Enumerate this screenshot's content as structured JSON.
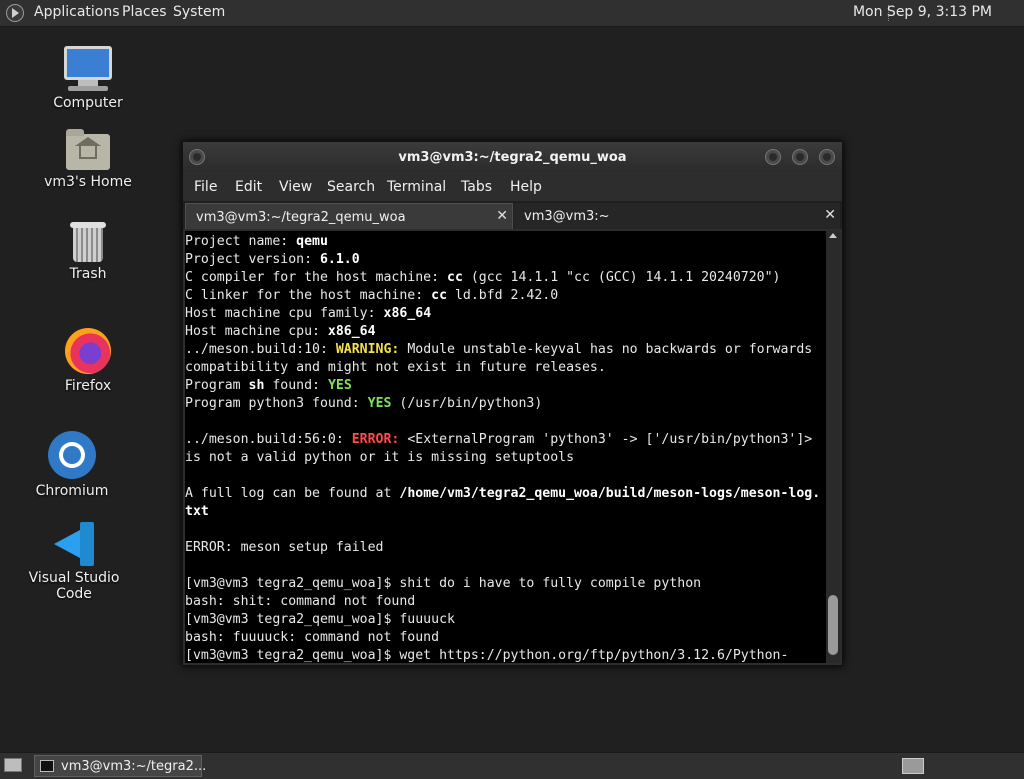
{
  "top_panel": {
    "menus": [
      "Applications",
      "Places",
      "System"
    ],
    "clock": "Mon Sep  9,  3:13 PM"
  },
  "desktop_icons": [
    {
      "label": "Computer",
      "icon": "computer-icon"
    },
    {
      "label": "vm3's Home",
      "icon": "home-folder-icon"
    },
    {
      "label": "Trash",
      "icon": "trash-icon"
    },
    {
      "label": "Firefox",
      "icon": "firefox-icon"
    },
    {
      "label": "Chromium",
      "icon": "chromium-icon"
    },
    {
      "label": "Visual Studio Code",
      "icon": "vscode-icon"
    }
  ],
  "terminal_window": {
    "title": "vm3@vm3:~/tegra2_qemu_woa",
    "menu": [
      "File",
      "Edit",
      "View",
      "Search",
      "Terminal",
      "Tabs",
      "Help"
    ],
    "tabs": [
      {
        "label": "vm3@vm3:~/tegra2_qemu_woa",
        "close": "✕",
        "active": true
      },
      {
        "label": "vm3@vm3:~",
        "close": "✕",
        "active": false
      }
    ],
    "lines": [
      [
        {
          "t": "Project name: "
        },
        {
          "t": "qemu",
          "s": "b"
        }
      ],
      [
        {
          "t": "Project version: "
        },
        {
          "t": "6.1.0",
          "s": "b"
        }
      ],
      [
        {
          "t": "C compiler for the host machine: "
        },
        {
          "t": "cc",
          "s": "b"
        },
        {
          "t": " (gcc 14.1.1 \"cc (GCC) 14.1.1 20240720\")"
        }
      ],
      [
        {
          "t": "C linker for the host machine: "
        },
        {
          "t": "cc",
          "s": "b"
        },
        {
          "t": " ld.bfd 2.42.0"
        }
      ],
      [
        {
          "t": "Host machine cpu family: "
        },
        {
          "t": "x86_64",
          "s": "b"
        }
      ],
      [
        {
          "t": "Host machine cpu: "
        },
        {
          "t": "x86_64",
          "s": "b"
        }
      ],
      [
        {
          "t": "../meson.build:10: "
        },
        {
          "t": "WARNING:",
          "s": "warn"
        },
        {
          "t": " Module unstable-keyval has no backwards or forwards"
        }
      ],
      [
        {
          "t": "compatibility and might not exist in future releases."
        }
      ],
      [
        {
          "t": "Program "
        },
        {
          "t": "sh",
          "s": "b"
        },
        {
          "t": " found: "
        },
        {
          "t": "YES",
          "s": "yes"
        }
      ],
      [
        {
          "t": "Program python3 found: "
        },
        {
          "t": "YES",
          "s": "yes"
        },
        {
          "t": " (/usr/bin/python3)"
        }
      ],
      [
        {
          "t": ""
        }
      ],
      [
        {
          "t": "../meson.build:56:0: "
        },
        {
          "t": "ERROR:",
          "s": "err"
        },
        {
          "t": " <ExternalProgram 'python3' -> ['/usr/bin/python3']>"
        }
      ],
      [
        {
          "t": "is not a valid python or it is missing setuptools"
        }
      ],
      [
        {
          "t": ""
        }
      ],
      [
        {
          "t": "A full log can be found at "
        },
        {
          "t": "/home/vm3/tegra2_qemu_woa/build/meson-logs/meson-log.",
          "s": "b"
        }
      ],
      [
        {
          "t": "txt",
          "s": "b"
        }
      ],
      [
        {
          "t": ""
        }
      ],
      [
        {
          "t": "ERROR: meson setup failed"
        }
      ],
      [
        {
          "t": ""
        }
      ],
      [
        {
          "t": "[vm3@vm3 tegra2_qemu_woa]$ shit do i have to fully compile python"
        }
      ],
      [
        {
          "t": "bash: shit: command not found"
        }
      ],
      [
        {
          "t": "[vm3@vm3 tegra2_qemu_woa]$ fuuuuck"
        }
      ],
      [
        {
          "t": "bash: fuuuuck: command not found"
        }
      ],
      [
        {
          "t": "[vm3@vm3 tegra2_qemu_woa]$ wget https://python.org/ftp/python/3.12.6/Python-"
        }
      ]
    ]
  },
  "bottom_panel": {
    "task_label": "vm3@vm3:~/tegra2..."
  },
  "colors": {
    "warning": "#f2e24a",
    "error": "#ff4b4b",
    "success": "#7fe05a",
    "terminal_bg": "#000000"
  }
}
